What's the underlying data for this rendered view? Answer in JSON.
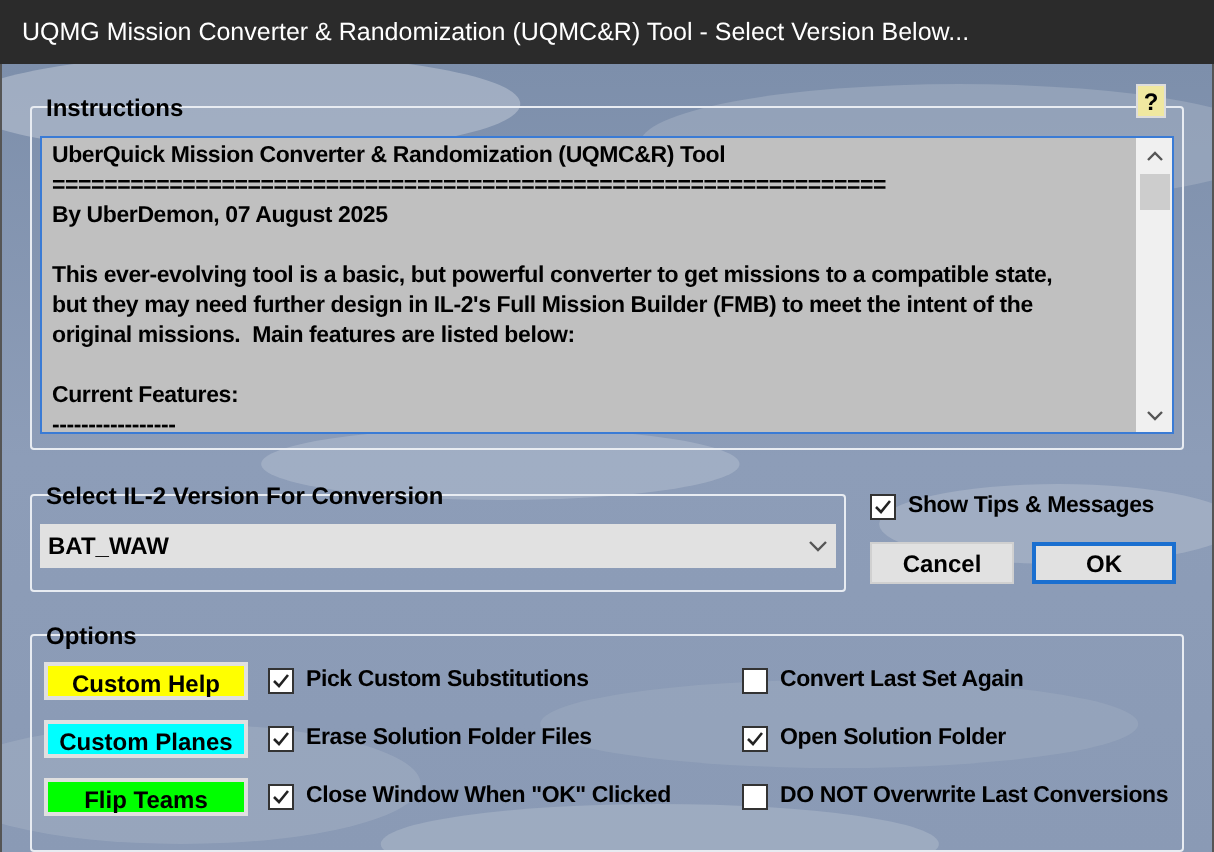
{
  "window": {
    "title": "UQMG Mission Converter & Randomization (UQMC&R) Tool - Select Version Below..."
  },
  "instructions": {
    "label": "Instructions",
    "help_button": "?",
    "sections": [
      [
        "UberQuick Mission Converter & Randomization (UQMC&R) Tool",
        "================================================================",
        "By UberDemon, 07 August 2025"
      ],
      [
        "This ever-evolving tool is a basic, but powerful converter to get missions to a compatible state,\nbut they may need further design in IL-2's Full Mission Builder (FMB) to meet the intent of the\noriginal missions.  Main features are listed below:"
      ],
      [
        "Current Features:",
        "-----------------"
      ]
    ]
  },
  "version": {
    "label": "Select IL-2 Version For Conversion",
    "value": "BAT_WAW"
  },
  "show_tips": {
    "label": "Show Tips & Messages",
    "checked": true
  },
  "buttons": [
    {
      "label": "Cancel",
      "default": false
    },
    {
      "label": "OK",
      "default": true
    }
  ],
  "options": {
    "label": "Options",
    "color_buttons": [
      {
        "label": "Custom Help",
        "color": "#ffff00"
      },
      {
        "label": "Custom Planes",
        "color": "#00ffff"
      },
      {
        "label": "Flip Teams",
        "color": "#00ff00"
      }
    ],
    "checkboxes": [
      [
        {
          "label": "Pick Custom Substitutions",
          "checked": true
        },
        {
          "label": "Convert Last Set Again",
          "checked": false
        }
      ],
      [
        {
          "label": "Erase Solution Folder Files",
          "checked": true
        },
        {
          "label": "Open Solution Folder",
          "checked": true
        }
      ],
      [
        {
          "label": "Close Window When \"OK\" Clicked",
          "checked": true
        },
        {
          "label": "DO NOT Overwrite Last Conversions",
          "checked": false
        }
      ]
    ]
  }
}
